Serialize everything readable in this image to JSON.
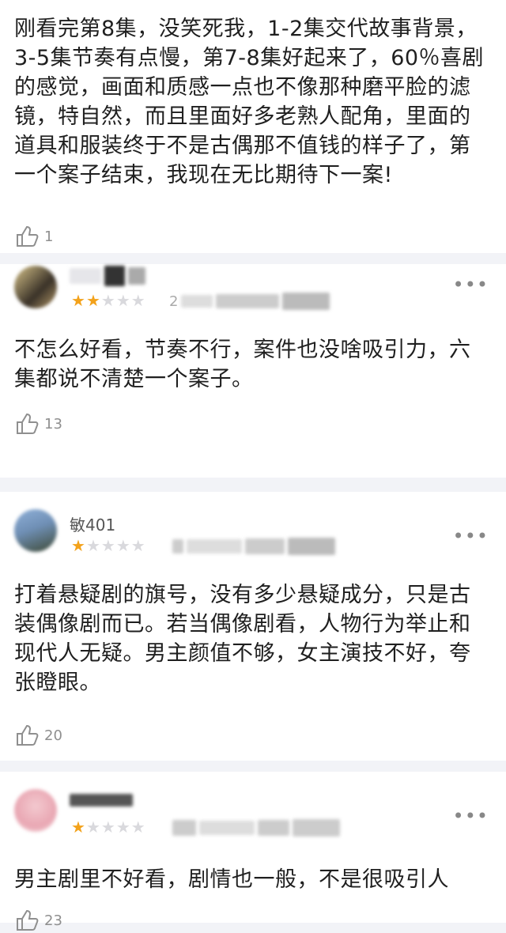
{
  "reviews": [
    {
      "text": "刚看完第8集，没笑死我，1-2集交代故事背景，3-5集节奏有点慢，第7-8集好起来了，60％喜剧的感觉，画面和质感一点也不像那种磨平脸的滤镜，特自然，而且里面好多老熟人配角，里面的道具和服装终于不是古偶那不值钱的样子了，第一个案子结束，我现在无比期待下一案!",
      "likes": "1"
    },
    {
      "user_name": "",
      "rating": 2,
      "date": "2",
      "text": "不怎么好看，节奏不行，案件也没啥吸引力，六集都说不清楚一个案子。",
      "likes": "13"
    },
    {
      "user_name": "敏401",
      "rating": 1,
      "date": "",
      "text": "打着悬疑剧的旗号，没有多少悬疑成分，只是古装偶像剧而已。若当偶像剧看，人物行为举止和现代人无疑。男主颜值不够，女主演技不好，夸张瞪眼。",
      "likes": "20"
    },
    {
      "user_name": "",
      "rating": 1,
      "date": "",
      "text": "男主剧里不好看，剧情也一般，不是很吸引人",
      "likes": "23"
    }
  ],
  "more_glyph": "•••",
  "colors": {
    "star_on": "#f3a21b",
    "star_off": "#d9d9dd",
    "background": "#f2f3f7",
    "card": "#ffffff"
  },
  "icons": {
    "like": "thumbs-up-icon",
    "more": "more-options-icon",
    "star": "star-icon"
  }
}
